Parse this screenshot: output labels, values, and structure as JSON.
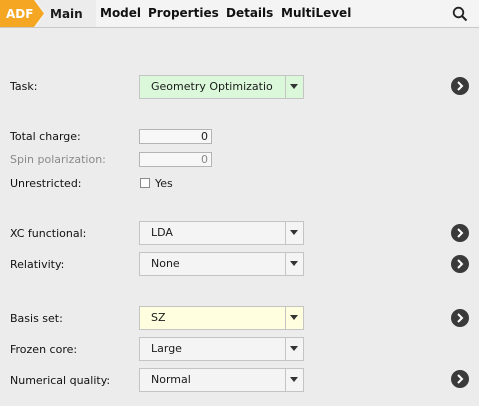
{
  "tabs": {
    "app": "ADF",
    "active": "Main",
    "items": [
      "Model",
      "Properties",
      "Details",
      "MultiLevel"
    ]
  },
  "colors": {
    "accent": "#f5a623",
    "task_field": "#dbf9da",
    "basis_field": "#ffffe0",
    "circle_button": "#3a3a3a"
  },
  "form": {
    "task": {
      "label": "Task:",
      "value": "Geometry Optimizatio"
    },
    "total_charge": {
      "label": "Total charge:",
      "value": "0"
    },
    "spin_polarization": {
      "label": "Spin polarization:",
      "value": "0"
    },
    "unrestricted": {
      "label": "Unrestricted:",
      "option": "Yes",
      "checked": false
    },
    "xc_functional": {
      "label": "XC functional:",
      "value": "LDA"
    },
    "relativity": {
      "label": "Relativity:",
      "value": "None"
    },
    "basis_set": {
      "label": "Basis set:",
      "value": "SZ"
    },
    "frozen_core": {
      "label": "Frozen core:",
      "value": "Large"
    },
    "numerical_quality": {
      "label": "Numerical quality:",
      "value": "Normal"
    }
  },
  "icons": {
    "search": "search-icon",
    "dropdown": "chevron-down-icon",
    "more": "chevron-right-circle-icon"
  }
}
